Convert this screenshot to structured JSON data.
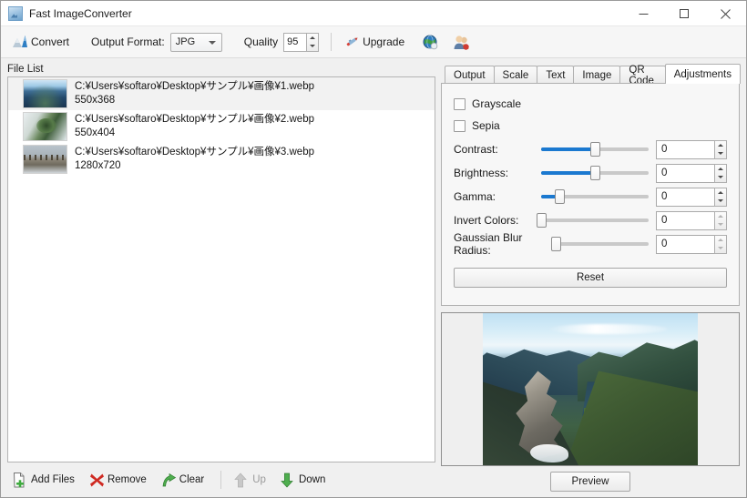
{
  "window": {
    "title": "Fast ImageConverter",
    "app_icon": "picture-icon",
    "controls": {
      "minimize": "minimize-icon",
      "maximize": "maximize-icon",
      "close": "close-icon"
    }
  },
  "toolbar": {
    "convert_label": "Convert",
    "convert_icon": "convert-mountain-icon",
    "output_format_label": "Output Format:",
    "output_format_value": "JPG",
    "output_format_options": [
      "JPG"
    ],
    "quality_label": "Quality",
    "quality_value": "95",
    "upgrade_label": "Upgrade",
    "upgrade_icon": "rocket-icon",
    "globe_icon": "globe-icon",
    "users_icon": "users-icon"
  },
  "file_list": {
    "title": "File List",
    "rows": [
      {
        "path": "C:¥Users¥softaro¥Desktop¥サンプル¥画像¥1.webp",
        "dimensions": "550x368",
        "thumb": "thumb-fjord",
        "selected": true
      },
      {
        "path": "C:¥Users¥softaro¥Desktop¥サンプル¥画像¥2.webp",
        "dimensions": "550x404",
        "thumb": "thumb-snow-aerial",
        "selected": false
      },
      {
        "path": "C:¥Users¥softaro¥Desktop¥サンプル¥画像¥3.webp",
        "dimensions": "1280x720",
        "thumb": "thumb-winter-trees",
        "selected": false
      }
    ]
  },
  "list_toolbar": {
    "add_files": {
      "label": "Add Files",
      "icon": "document-add-icon",
      "enabled": true
    },
    "remove": {
      "label": "Remove",
      "icon": "red-x-icon",
      "enabled": true
    },
    "clear": {
      "label": "Clear",
      "icon": "green-arrow-icon",
      "enabled": true
    },
    "up": {
      "label": "Up",
      "icon": "arrow-up-icon",
      "enabled": false
    },
    "down": {
      "label": "Down",
      "icon": "arrow-down-icon",
      "enabled": true
    }
  },
  "tabs": {
    "items": [
      {
        "label": "Output",
        "active": false
      },
      {
        "label": "Scale",
        "active": false
      },
      {
        "label": "Text",
        "active": false
      },
      {
        "label": "Image",
        "active": false
      },
      {
        "label": "QR Code",
        "active": false
      },
      {
        "label": "Adjustments",
        "active": true
      }
    ]
  },
  "adjustments": {
    "grayscale": {
      "label": "Grayscale",
      "checked": false
    },
    "sepia": {
      "label": "Sepia",
      "checked": false
    },
    "sliders": [
      {
        "label": "Contrast:",
        "value": "0",
        "percent": 50
      },
      {
        "label": "Brightness:",
        "value": "0",
        "percent": 50
      },
      {
        "label": "Gamma:",
        "value": "0",
        "percent": 17
      },
      {
        "label": "Invert Colors:",
        "value": "0",
        "percent": 0
      },
      {
        "label": "Gaussian Blur Radius:",
        "value": "0",
        "percent": 0
      }
    ],
    "reset_label": "Reset"
  },
  "preview": {
    "image": "fjord-valley-landscape",
    "button_label": "Preview"
  },
  "colors": {
    "accent_blue": "#1b79d0",
    "window_bg": "#f0f0f0",
    "panel_bg": "#f7f7f7",
    "selection": "#f2f2f2",
    "border": "#b0b0b0"
  }
}
